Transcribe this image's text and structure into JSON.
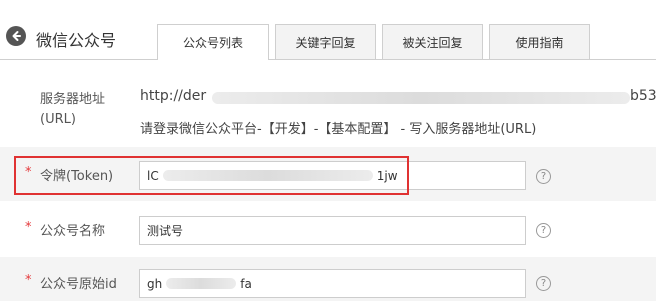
{
  "header": {
    "title": "微信公众号",
    "tabs": [
      {
        "label": "公众号列表",
        "active": true
      },
      {
        "label": "关键字回复",
        "active": false
      },
      {
        "label": "被关注回复",
        "active": false
      },
      {
        "label": "使用指南",
        "active": false
      }
    ]
  },
  "form": {
    "server_url": {
      "label": "服务器地址",
      "label_sub": "(URL)",
      "value_prefix": "http://der",
      "value_suffix": "b53",
      "hint": "请登录微信公众平台-【开发】-【基本配置】 - 写入服务器地址(URL)"
    },
    "token": {
      "required_mark": "*",
      "label": "令牌(Token)",
      "value_prefix": "lC",
      "value_suffix": "1jw"
    },
    "account_name": {
      "required_mark": "*",
      "label": "公众号名称",
      "value": "测试号"
    },
    "original_id": {
      "required_mark": "*",
      "label": "公众号原始id",
      "value_prefix": "gh",
      "value_suffix": "fa"
    },
    "help_glyph": "?"
  },
  "colors": {
    "required": "#e4393c",
    "highlight": "#e03232",
    "row_gray": "#f4f4f4"
  }
}
